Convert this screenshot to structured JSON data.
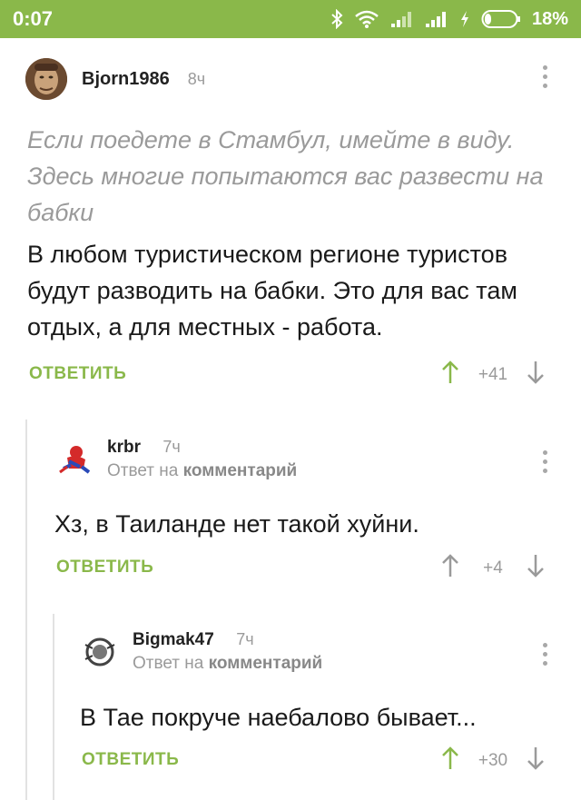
{
  "status_bar": {
    "time": "0:07",
    "battery": "18%",
    "accent": "#8ab84a"
  },
  "comments": [
    {
      "author": "Bjorn1986",
      "time": "8ч",
      "quote": [
        "Если поедете в Стамбул, имейте в виду.",
        "Здесь многие попытаются вас развести на",
        "бабки"
      ],
      "text": [
        "В любом туристическом регионе туристов",
        "будут разводить на бабки. Это для вас там",
        "отдых, а для местных - работа."
      ],
      "reply_label": "ОТВЕТИТЬ",
      "score": "+41"
    },
    {
      "author": "krbr",
      "time": "7ч",
      "reply_to_prefix": "Ответ на",
      "reply_to_target": "комментарий",
      "text": [
        "Хз, в Таиланде нет такой хуйни."
      ],
      "reply_label": "ОТВЕТИТЬ",
      "score": "+4"
    },
    {
      "author": "Bigmak47",
      "time": "7ч",
      "reply_to_prefix": "Ответ на",
      "reply_to_target": "комментарий",
      "text": [
        "В Тае покруче наебалово бывает..."
      ],
      "reply_label": "ОТВЕТИТЬ",
      "score": "+30"
    }
  ]
}
